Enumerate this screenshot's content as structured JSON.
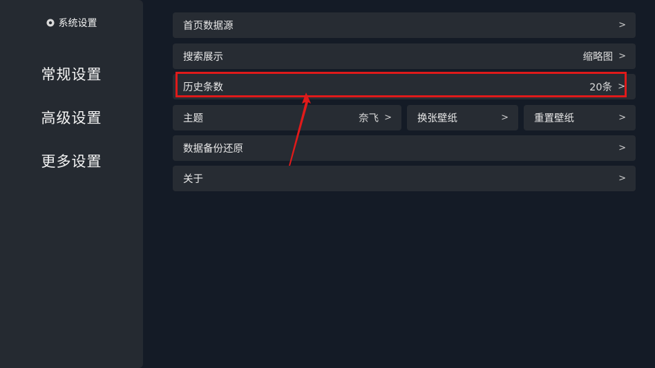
{
  "sidebar": {
    "header": "系统设置",
    "items": [
      {
        "label": "常规设置"
      },
      {
        "label": "高级设置"
      },
      {
        "label": "更多设置"
      }
    ]
  },
  "settings": {
    "home_source": {
      "label": "首页数据源",
      "chevron": ">"
    },
    "search_display": {
      "label": "搜索展示",
      "value": "缩略图",
      "chevron": ">"
    },
    "history_count": {
      "label": "历史条数",
      "value": "20条",
      "chevron": ">"
    },
    "theme": {
      "label": "主题",
      "value": "奈飞",
      "chevron": ">"
    },
    "change_wallpaper": {
      "label": "换张壁纸",
      "chevron": ">"
    },
    "reset_wallpaper": {
      "label": "重置壁纸",
      "chevron": ">"
    },
    "backup_restore": {
      "label": "数据备份还原",
      "chevron": ">"
    },
    "about": {
      "label": "关于",
      "chevron": ">"
    }
  },
  "annotation": {
    "highlight_color": "#e01a1a"
  },
  "colors": {
    "background": "#141b26",
    "panel": "#252a31",
    "row": "#272c33"
  }
}
